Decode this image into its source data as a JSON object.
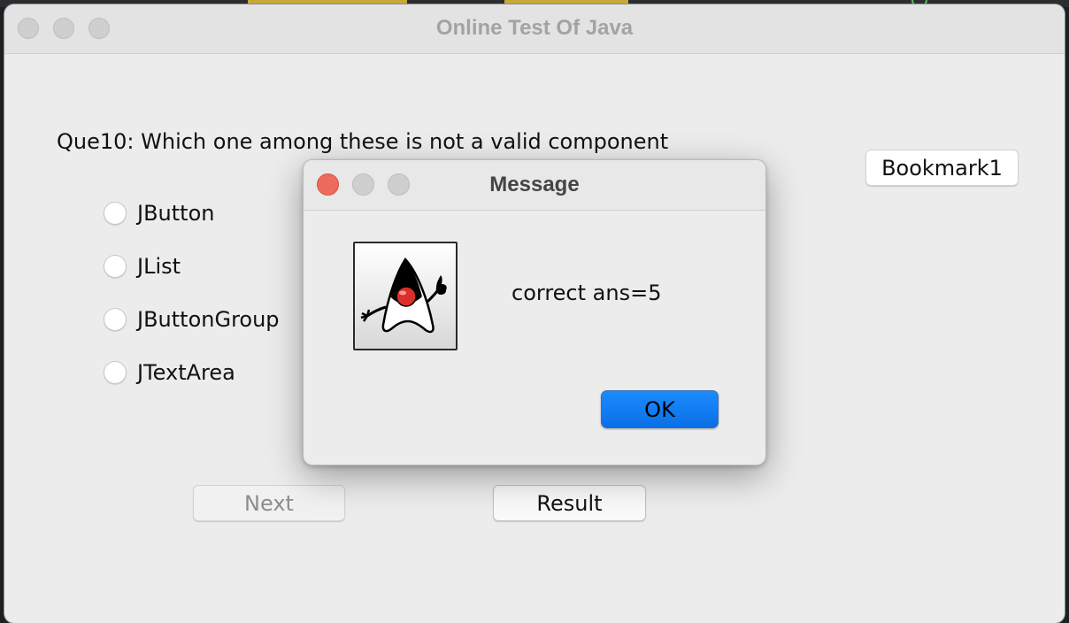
{
  "window": {
    "title": "Online Test Of Java"
  },
  "question": {
    "text": "Que10: Which one among these is not a valid component",
    "options": [
      {
        "label": "JButton",
        "selected": false
      },
      {
        "label": "JList",
        "selected": false
      },
      {
        "label": "JButtonGroup",
        "selected": false
      },
      {
        "label": "JTextArea",
        "selected": false
      }
    ]
  },
  "buttons": {
    "bookmark": "Bookmark1",
    "next": "Next",
    "next_enabled": false,
    "result": "Result"
  },
  "dialog": {
    "title": "Message",
    "message": "correct ans=5",
    "ok": "OK",
    "icon": "java-duke-icon"
  },
  "colors": {
    "ok_button": "#0a7aff",
    "close_light": "#ee6a5f"
  }
}
